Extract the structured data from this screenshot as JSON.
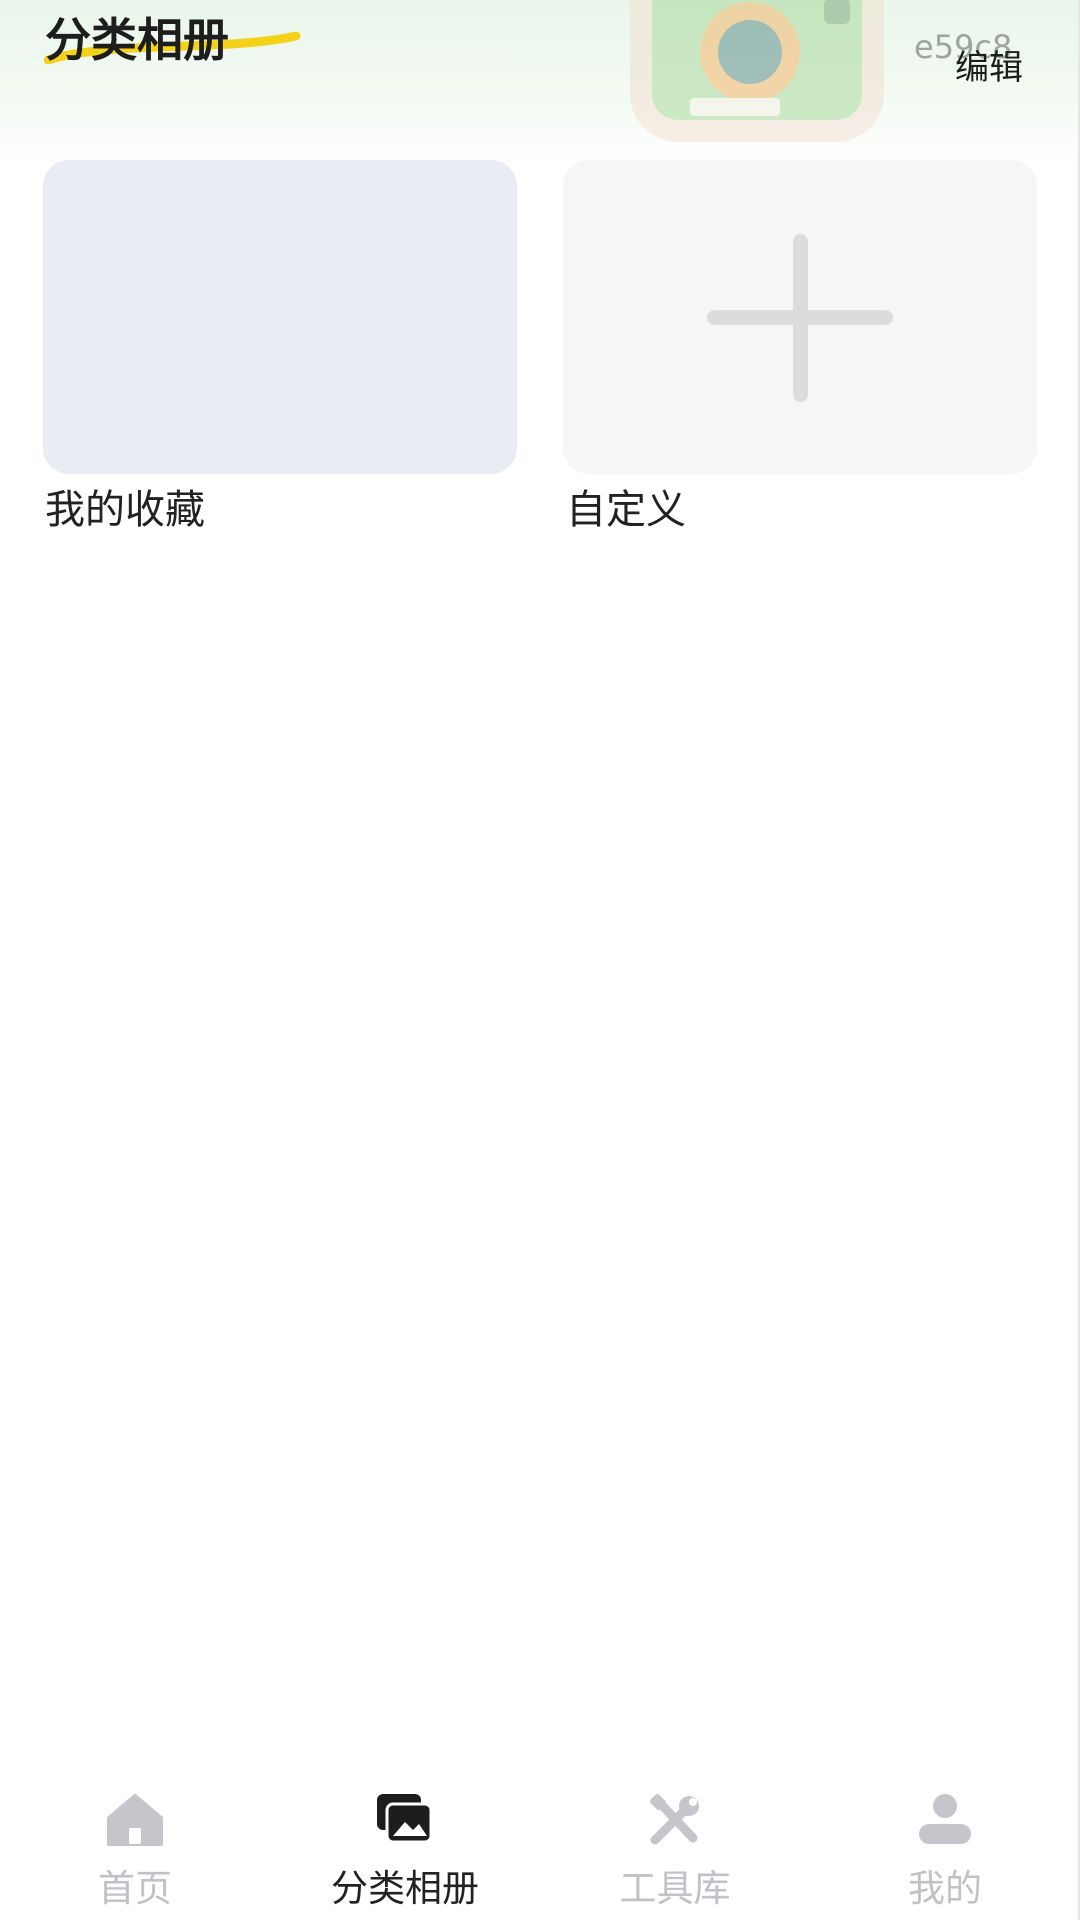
{
  "header": {
    "title": "分类相册",
    "build_tag": "e59c8",
    "edit_label": "编辑",
    "underline_color": "#f5d21a"
  },
  "albums": [
    {
      "label": "我的收藏",
      "icon": null
    },
    {
      "label": "自定义",
      "icon": "plus-icon"
    }
  ],
  "tabbar": {
    "active_index": 1,
    "tabs": [
      {
        "label": "首页",
        "icon": "home-icon"
      },
      {
        "label": "分类相册",
        "icon": "photo-album-icon"
      },
      {
        "label": "工具库",
        "icon": "tools-icon"
      },
      {
        "label": "我的",
        "icon": "person-icon"
      }
    ],
    "colors": {
      "active": "#222222",
      "inactive": "#bfc2c7"
    }
  }
}
